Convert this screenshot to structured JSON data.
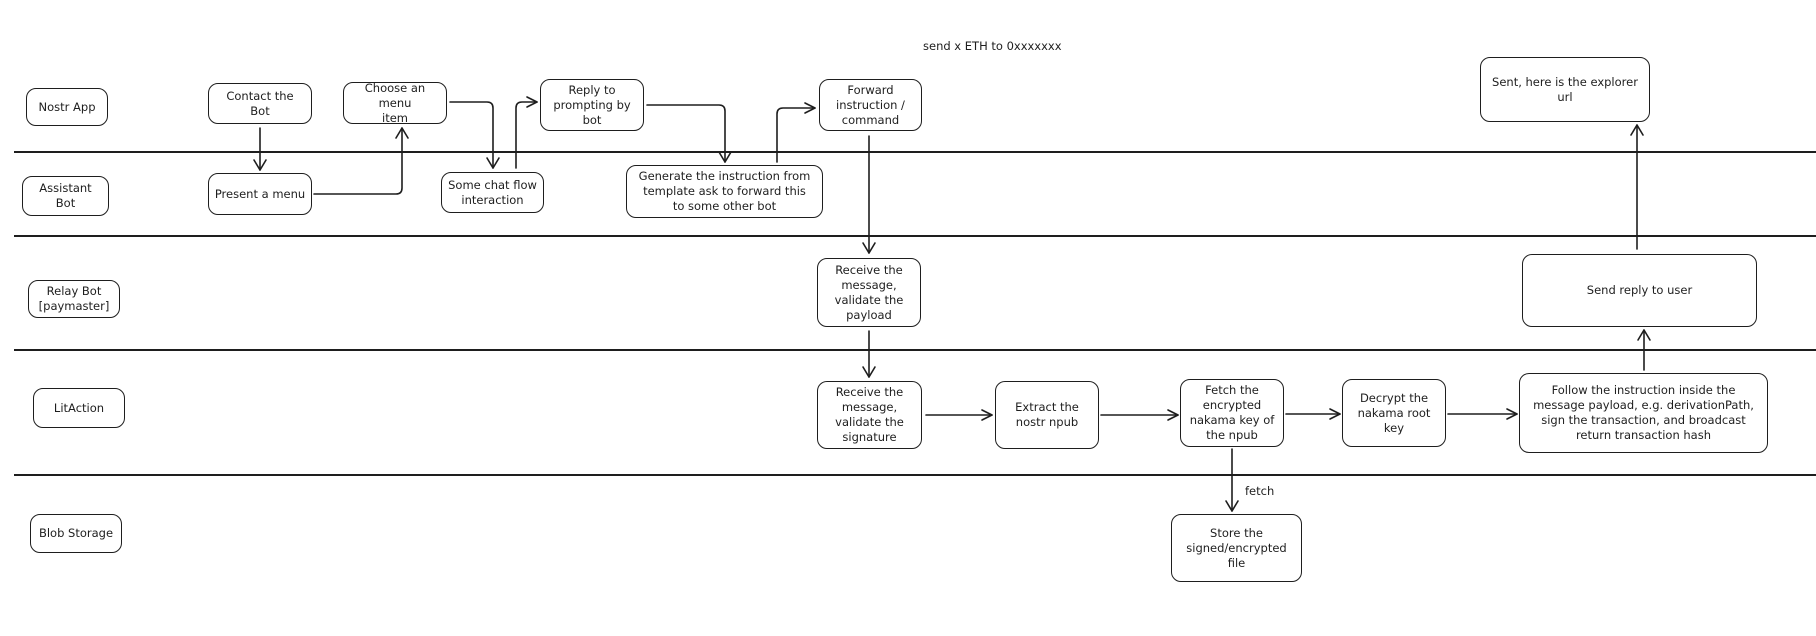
{
  "title": "send x ETH to 0xxxxxxx",
  "lanes": [
    {
      "id": "nostr-app",
      "label": "Nostr App"
    },
    {
      "id": "assistant-bot",
      "label": "Assistant\nBot"
    },
    {
      "id": "relay-bot",
      "label": "Relay Bot\n[paymaster]"
    },
    {
      "id": "litaction",
      "label": "LitAction"
    },
    {
      "id": "blob-storage",
      "label": "Blob Storage"
    }
  ],
  "nodes": {
    "contact_bot": "Contact the\nBot",
    "present_menu": "Present a menu",
    "choose_menu_item": "Choose an menu\nitem",
    "chat_flow": "Some chat flow\ninteraction",
    "reply_prompting": "Reply to\nprompting by\nbot",
    "generate_instruction": "Generate the instruction from\ntemplate ask to forward this\nto some other bot",
    "forward_instruction": "Forward\ninstruction /\ncommand",
    "receive_validate_payload": "Receive the\nmessage,\nvalidate the\npayload",
    "receive_validate_signature": "Receive the\nmessage,\nvalidate the\nsignature",
    "extract_npub": "Extract the\nnostr npub",
    "fetch_encrypted_key": "Fetch the\nencrypted\nnakama key of\nthe npub",
    "decrypt_root_key": "Decrypt the\nnakama root\nkey",
    "follow_instruction": "Follow the instruction inside the\nmessage payload, e.g. derivationPath,\nsign the transaction, and broadcast\nreturn transaction hash",
    "store_file": "Store the\nsigned/encrypted\nfile",
    "send_reply": "Send reply to user",
    "sent_explorer_url": "Sent, here is the explorer url"
  },
  "edge_labels": {
    "fetch": "fetch"
  },
  "edges": [
    {
      "from": "contact_bot",
      "to": "present_menu"
    },
    {
      "from": "present_menu",
      "to": "choose_menu_item"
    },
    {
      "from": "choose_menu_item",
      "to": "chat_flow"
    },
    {
      "from": "chat_flow",
      "to": "reply_prompting"
    },
    {
      "from": "reply_prompting",
      "to": "generate_instruction"
    },
    {
      "from": "generate_instruction",
      "to": "forward_instruction"
    },
    {
      "from": "forward_instruction",
      "to": "receive_validate_payload"
    },
    {
      "from": "receive_validate_payload",
      "to": "receive_validate_signature"
    },
    {
      "from": "receive_validate_signature",
      "to": "extract_npub"
    },
    {
      "from": "extract_npub",
      "to": "fetch_encrypted_key"
    },
    {
      "from": "fetch_encrypted_key",
      "to": "decrypt_root_key"
    },
    {
      "from": "fetch_encrypted_key",
      "to": "store_file",
      "label": "fetch"
    },
    {
      "from": "decrypt_root_key",
      "to": "follow_instruction"
    },
    {
      "from": "follow_instruction",
      "to": "send_reply"
    },
    {
      "from": "send_reply",
      "to": "sent_explorer_url"
    }
  ]
}
